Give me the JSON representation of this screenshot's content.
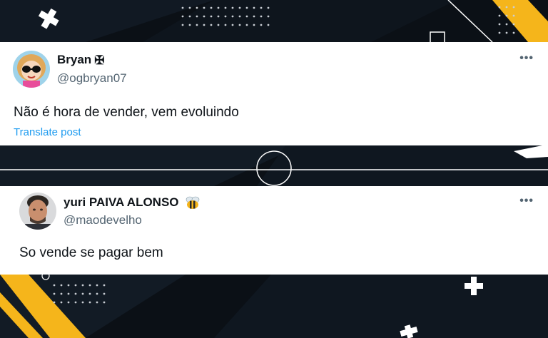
{
  "posts": [
    {
      "display_name": "Bryan",
      "name_badge": "✠",
      "handle": "@ogbryan07",
      "text": "Não é hora de vender, vem evoluindo",
      "translate_label": "Translate post",
      "more_label": "•••",
      "avatar_icon": "cartoon-girl-sunglasses-avatar"
    },
    {
      "display_name": "yuri PAIVA ALONSO",
      "name_badge": "bee-emoji",
      "handle": "@maodevelho",
      "text": "So vende se pagar bem",
      "more_label": "•••",
      "avatar_icon": "man-portrait-avatar"
    }
  ],
  "colors": {
    "background": "#0b1016",
    "accent_yellow": "#f5b51b",
    "link_blue": "#1d9bf0",
    "text_primary": "#0f1419",
    "text_secondary": "#536471"
  }
}
